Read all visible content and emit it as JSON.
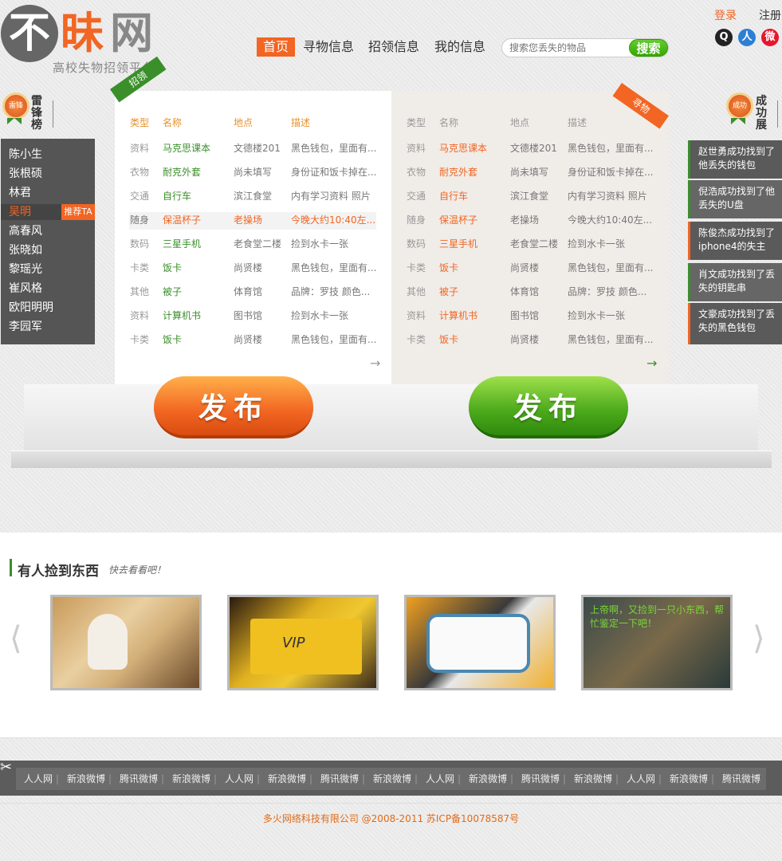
{
  "logo": {
    "char1": "不",
    "char2": "昧",
    "char3": "网",
    "subtitle": "高校失物招领平台"
  },
  "nav": [
    {
      "label": "首页"
    },
    {
      "label": "寻物信息"
    },
    {
      "label": "招领信息"
    },
    {
      "label": "我的信息"
    }
  ],
  "search": {
    "placeholder": "搜索您丢失的物品",
    "button": "搜索"
  },
  "account": {
    "login": "登录",
    "register": "注册"
  },
  "social": {
    "qq": "Q",
    "renren": "人",
    "weibo": "微"
  },
  "left_rank": {
    "badge": "雷锋",
    "title": "雷锋榜",
    "names": [
      "陈小生",
      "张根硕",
      "林君",
      "吴明",
      "高春风",
      "张晓如",
      "黎瑶光",
      "崔风格",
      "欧阳明明",
      "李园军"
    ],
    "recommend": "推荐TA"
  },
  "right_rank": {
    "badge": "成功",
    "title": "成功展",
    "items": [
      "赵世勇成功找到了他丢失的钱包",
      "倪浩成功找到了他丢失的U盘",
      "陈俊杰成功找到了iphone4的失主",
      "肖文成功找到了丢失的钥匙串",
      "文豪成功找到了丢失的黑色钱包"
    ]
  },
  "panels": {
    "found_tag": "招领",
    "lost_tag": "寻物",
    "headers": [
      "类型",
      "名称",
      "地点",
      "描述"
    ],
    "left_rows": [
      [
        "资料",
        "马克思课本",
        "文德楼201",
        "黑色钱包，里面有..."
      ],
      [
        "衣物",
        "耐克外套",
        "尚未填写",
        "身份证和饭卡掉在..."
      ],
      [
        "交通",
        "自行车",
        "滨江食堂",
        "内有学习资料 照片"
      ],
      [
        "随身",
        "保温杯子",
        "老操场",
        "今晚大约10:40左..."
      ],
      [
        "数码",
        "三星手机",
        "老食堂二楼",
        "捡到水卡一张"
      ],
      [
        "卡类",
        "饭卡",
        "尚贤楼",
        "黑色钱包，里面有..."
      ],
      [
        "其他",
        "被子",
        "体育馆",
        "品牌：罗技 颜色..."
      ],
      [
        "资料",
        "计算机书",
        "图书馆",
        "捡到水卡一张"
      ],
      [
        "卡类",
        "饭卡",
        "尚贤楼",
        "黑色钱包，里面有..."
      ]
    ],
    "right_rows": [
      [
        "资料",
        "马克思课本",
        "文德楼201",
        "黑色钱包，里面有..."
      ],
      [
        "衣物",
        "耐克外套",
        "尚未填写",
        "身份证和饭卡掉在..."
      ],
      [
        "交通",
        "自行车",
        "滨江食堂",
        "内有学习资料 照片"
      ],
      [
        "随身",
        "保温杯子",
        "老操场",
        "今晚大约10:40左..."
      ],
      [
        "数码",
        "三星手机",
        "老食堂二楼",
        "捡到水卡一张"
      ],
      [
        "卡类",
        "饭卡",
        "尚贤楼",
        "黑色钱包，里面有..."
      ],
      [
        "其他",
        "被子",
        "体育馆",
        "品牌：罗技 颜色..."
      ],
      [
        "资料",
        "计算机书",
        "图书馆",
        "捡到水卡一张"
      ],
      [
        "卡类",
        "饭卡",
        "尚贤楼",
        "黑色钱包，里面有..."
      ]
    ],
    "publish": "发布"
  },
  "found_section": {
    "title": "有人捡到东西",
    "subtitle": "快去看看吧！",
    "thumb4_caption": "上帝啊，又捡到一只小东西，帮忙鉴定一下吧！",
    "card_text": "VIP"
  },
  "footer": {
    "links": [
      "人人网",
      "新浪微博",
      "腾讯微博",
      "新浪微博",
      "人人网",
      "新浪微博",
      "腾讯微博",
      "新浪微博",
      "人人网",
      "新浪微博",
      "腾讯微博",
      "新浪微博",
      "人人网",
      "新浪微博",
      "腾讯微博"
    ],
    "copyright": "多火网络科技有限公司 @2008-2011 苏ICP备10078587号"
  },
  "colors": {
    "accent": "#f26522",
    "green": "#3a8f2a",
    "dark": "#555555"
  }
}
